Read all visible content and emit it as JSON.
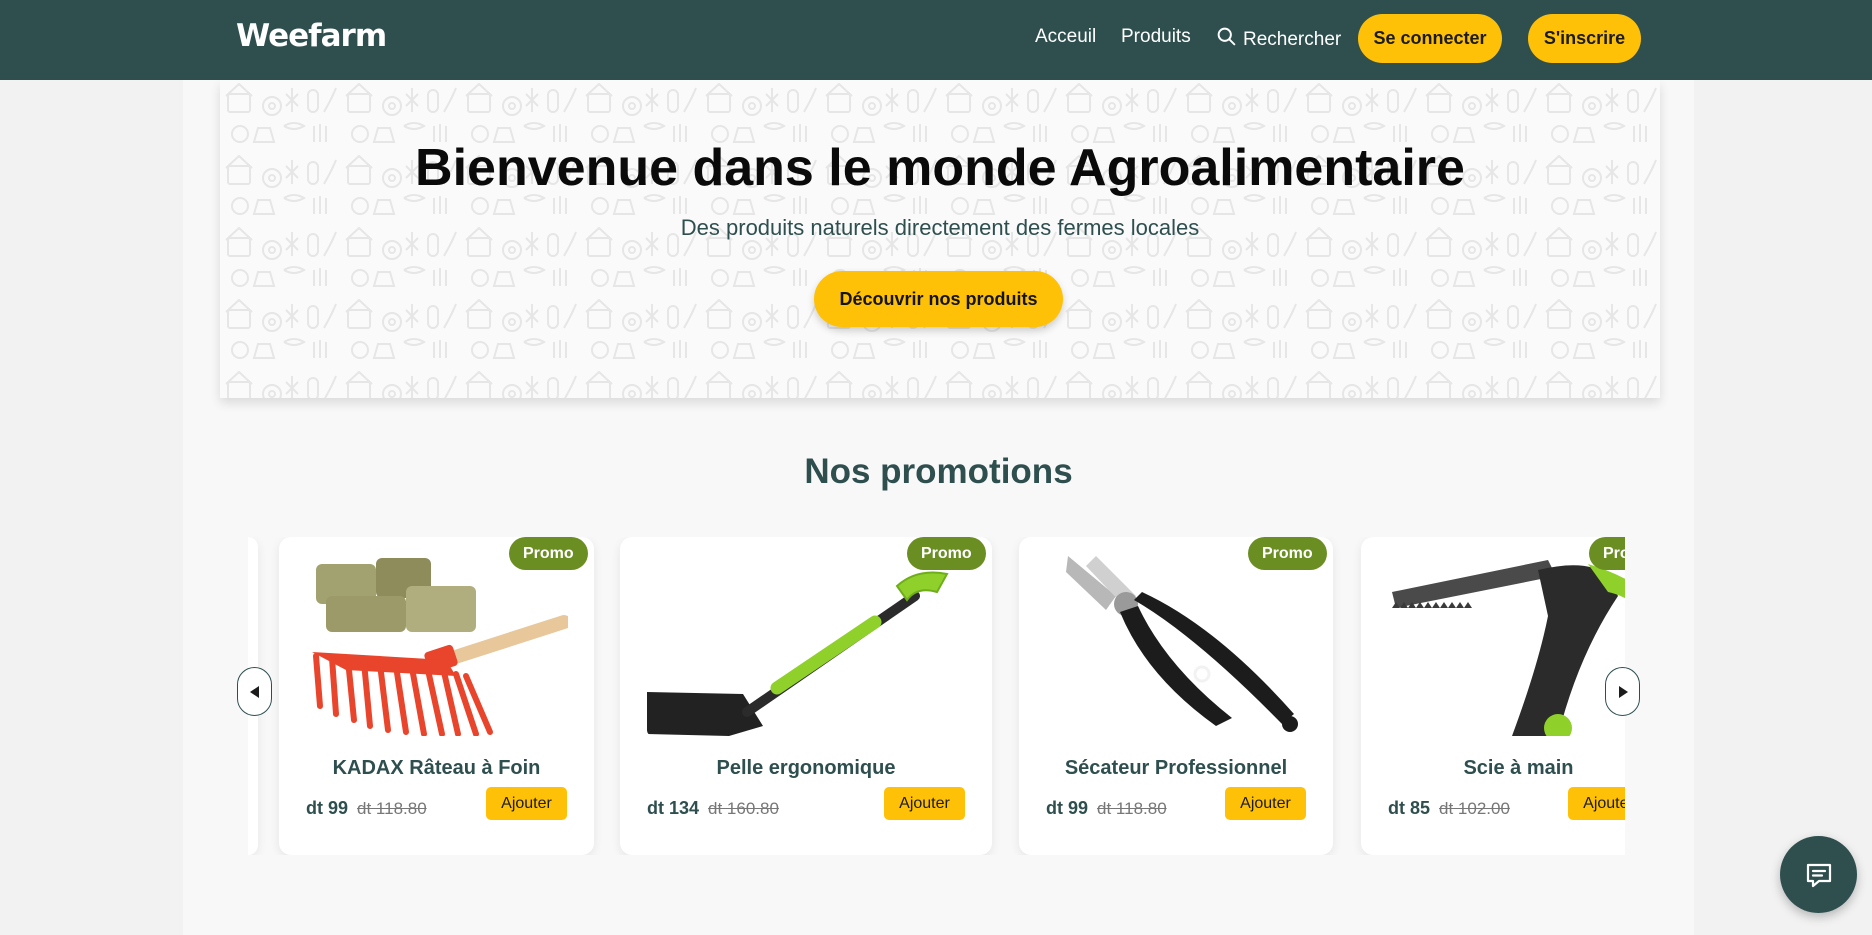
{
  "nav": {
    "brand": "Weefarm",
    "links": {
      "home": "Acceuil",
      "products": "Produits",
      "search": "Rechercher"
    },
    "login": "Se connecter",
    "signup": "S'inscrire"
  },
  "hero": {
    "title": "Bienvenue dans le monde Agroalimentaire",
    "subtitle": "Des produits naturels directement des fermes locales",
    "cta": "Découvrir nos produits"
  },
  "promotions": {
    "title": "Nos promotions",
    "badge": "Promo",
    "add_label": "Ajouter",
    "products": [
      {
        "name": "KADAX Râteau à Foin",
        "price": "dt 99",
        "old_price": "dt 118.80",
        "icon": "rake-icon"
      },
      {
        "name": "Pelle ergonomique",
        "price": "dt 134",
        "old_price": "dt 160.80",
        "icon": "shovel-icon"
      },
      {
        "name": "Sécateur Professionnel",
        "price": "dt 99",
        "old_price": "dt 118.80",
        "icon": "pruning-shears-icon"
      },
      {
        "name": "Scie à main",
        "price": "dt 85",
        "old_price": "dt 102.00",
        "icon": "hand-saw-icon"
      }
    ]
  },
  "colors": {
    "primary": "#2f4f4f",
    "accent": "#ffc107",
    "promo_badge": "#6b8e23",
    "background": "#f2f2f2"
  },
  "icons": {
    "search": "search-icon",
    "prev": "caret-left-icon",
    "next": "caret-right-icon",
    "chat": "chat-icon"
  }
}
